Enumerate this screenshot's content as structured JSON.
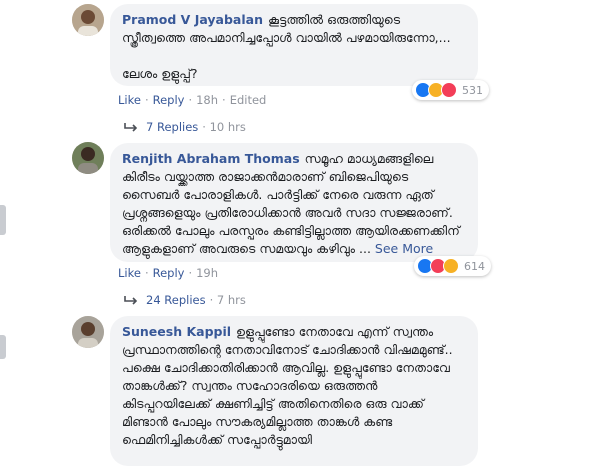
{
  "comments": [
    {
      "author": "Pramod V Jayabalan",
      "text": "കൂട്ടത്തിൽ ഒരുത്തിയുടെ സ്ത്രീത്വത്തെ അപമാനിച്ചപ്പോൾ വായിൽ പഴമായിരുന്നോ,...\n\nലേശം ഉളുപ്പ്?",
      "like": "Like",
      "reply": "Reply",
      "time": "18h",
      "edited": "Edited",
      "reaction_count": "531",
      "reactions": [
        "like-icon",
        "laugh-icon",
        "love-icon"
      ],
      "replies_label": "7 Replies",
      "replies_time": "· 10 hrs"
    },
    {
      "author": "Renjith Abraham Thomas",
      "text": "സമൂഹ മാധ്യമങ്ങളിലെ കിരീടം വയ്ക്കാത്ത രാജാക്കൻമാരാണ് ബിജെപിയുടെ സൈബർ പോരാളികൾ. പാർട്ടിക്ക് നേരെ വരുന്ന ഏത് പ്രശ്നങ്ങളെയും പ്രതിരോധിക്കാൻ അവർ സദാ സജ്ജരാണ്. ഒരിക്കൽ പോലും പരസ്പരം കണ്ടിട്ടില്ലാത്ത ആയിരക്കണക്കിന് ആളുകളാണ് അവരുടെ സമയവും കഴിവും ...",
      "see_more": "See More",
      "like": "Like",
      "reply": "Reply",
      "time": "19h",
      "reaction_count": "614",
      "reactions": [
        "like-icon",
        "love-icon",
        "laugh-icon"
      ],
      "replies_label": "24 Replies",
      "replies_time": "· 7 hrs"
    },
    {
      "author": "Suneesh Kappil",
      "text": "ഉളുപ്പുണ്ടോ നേതാവേ എന്ന് സ്വന്തം പ്രസ്ഥാനത്തിന്റെ നേതാവിനോട് ചോദിക്കാൻ വിഷമമുണ്ട്.. പക്ഷെ ചോദിക്കാതിരിക്കാൻ ആവില്ല. ഉളുപ്പുണ്ടോ നേതാവേ താങ്കൾക്ക്? സ്വന്തം സഹോദരിയെ ഒരുത്തൻ കിടപ്പറയിലേക്ക് ക്ഷണിച്ചിട്ട് അതിനെതിരെ ഒരു വാക്ക് മിണ്ടാൻ പോലും സൗകര്യമില്ലാത്ത താങ്കൾ കണ്ട ഫെമിനിച്ചികൾക്ക് സപ്പോർട്ടുമായി"
    }
  ],
  "colors": {
    "link": "#385898",
    "bubble": "#f2f3f5",
    "meta": "#90949c"
  }
}
